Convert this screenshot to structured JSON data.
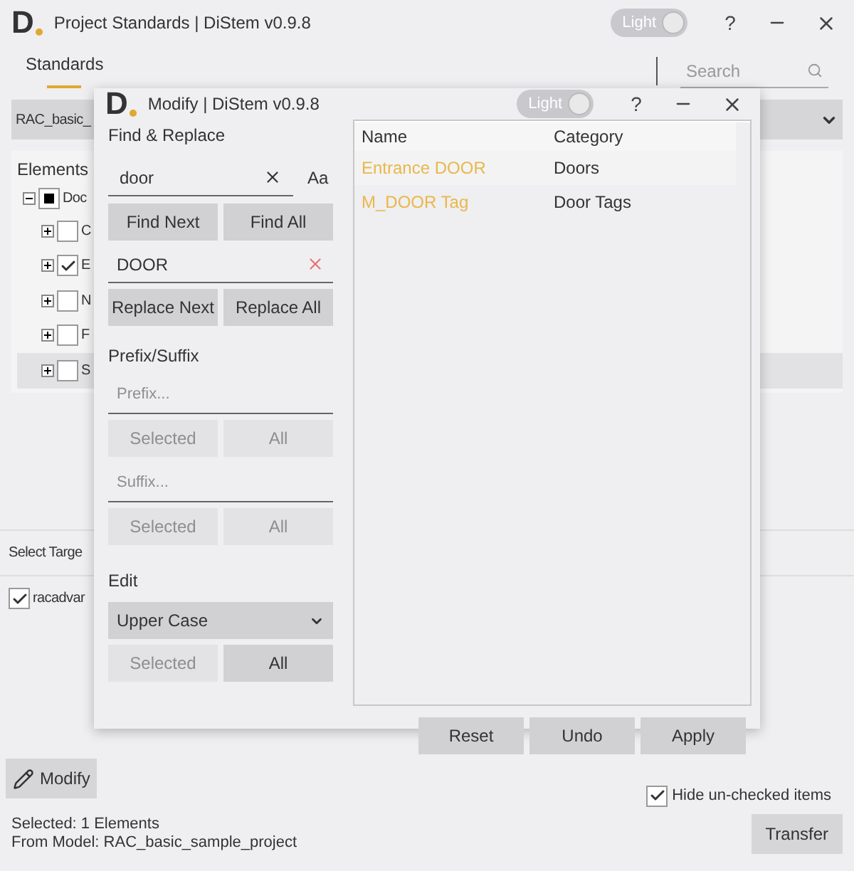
{
  "window": {
    "title": "Project Standards | DiStem v0.9.8",
    "logo": "D",
    "theme_toggle": "Light",
    "help_button": "?"
  },
  "tabs": [
    {
      "label": "Standards",
      "selected": true
    }
  ],
  "search": {
    "placeholder": "Search"
  },
  "model_dropdown": {
    "value": "RAC_basic_"
  },
  "elements": {
    "title": "Elements",
    "tree": [
      {
        "label": "Doc",
        "checked": false,
        "indeterminate": true,
        "expanded": true,
        "children": [
          {
            "label": "C",
            "checked": false,
            "expanded": false
          },
          {
            "label": "E",
            "checked": true,
            "expanded": false
          },
          {
            "label": "N",
            "checked": false,
            "expanded": false
          },
          {
            "label": "F",
            "checked": false,
            "expanded": false
          },
          {
            "label": "S",
            "checked": false,
            "expanded": false
          }
        ]
      }
    ]
  },
  "targets": {
    "title": "Select Targe",
    "items": [
      {
        "label": "racadvar",
        "checked": true
      }
    ]
  },
  "modify_button": "Modify",
  "hide_unchecked": {
    "label": "Hide un-checked items",
    "checked": true
  },
  "footer": {
    "selected": "Selected: 1 Elements",
    "from_model": "From Model: RAC_basic_sample_project",
    "transfer_button": "Transfer"
  },
  "dialog": {
    "title": "Modify | DiStem v0.9.8",
    "logo": "D",
    "theme_toggle": "Light",
    "help_button": "?",
    "find_replace": {
      "title": "Find & Replace",
      "find_value": "door",
      "match_case": "Aa",
      "find_next": "Find Next",
      "find_all": "Find All",
      "replace_value": "DOOR",
      "replace_next": "Replace Next",
      "replace_all": "Replace All"
    },
    "prefix_suffix": {
      "title": "Prefix/Suffix",
      "prefix_placeholder": "Prefix...",
      "prefix_buttons": [
        {
          "label": "Selected",
          "disabled": true
        },
        {
          "label": "All",
          "disabled": true
        }
      ],
      "suffix_placeholder": "Suffix...",
      "suffix_buttons": [
        {
          "label": "Selected",
          "disabled": true
        },
        {
          "label": "All",
          "disabled": true
        }
      ]
    },
    "edit": {
      "title": "Edit",
      "mode": "Upper Case",
      "buttons": [
        {
          "label": "Selected",
          "disabled": true
        },
        {
          "label": "All",
          "disabled": false
        }
      ]
    },
    "table": {
      "columns": [
        "Name",
        "Category"
      ],
      "rows": [
        {
          "name": "Entrance DOOR",
          "category": "Doors",
          "matched": true
        },
        {
          "name": "M_DOOR Tag",
          "category": "Door Tags",
          "matched": true
        }
      ]
    },
    "actions": [
      "Reset",
      "Undo",
      "Apply"
    ]
  }
}
